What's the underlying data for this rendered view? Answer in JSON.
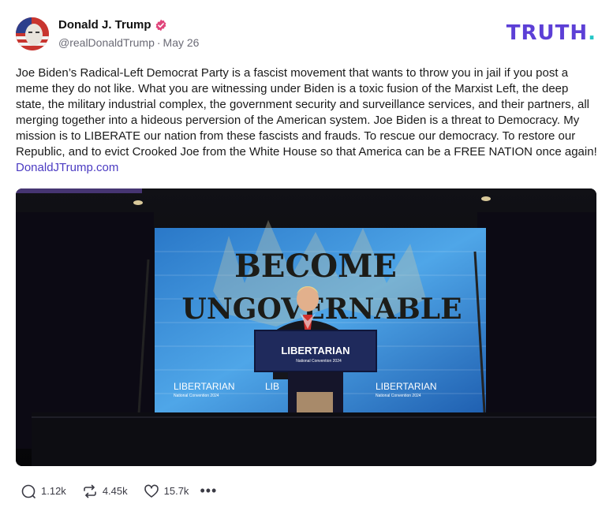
{
  "author": {
    "name": "Donald J. Trump",
    "handle": "@realDonaldTrump",
    "date": "May 26"
  },
  "brand": {
    "logo_text": "TRUTH",
    "logo_dot": ".",
    "color": "#5c3fd6",
    "dot_color": "#26c6c6"
  },
  "post": {
    "text": "Joe Biden’s Radical-Left Democrat Party is a fascist movement that wants to throw you in jail if you post a meme they do not like. What you are witnessing under Biden is a toxic fusion of the Marxist Left, the deep state, the military industrial complex, the government security and surveillance services, and their partners, all merging together into a hideous perversion of the American system. Joe Biden is a threat to Democracy. My mission is to LIBERATE our nation from these fascists and frauds. To rescue our democracy. To restore our Republic, and to evict Crooked Joe from the White House so that America can be a FREE NATION once again!",
    "link": "DonaldJTrump.com"
  },
  "image": {
    "screen_line1": "BECOME",
    "screen_line2": "UNGOVERNABLE",
    "podium_title": "LIBERTARIAN",
    "podium_subtitle": "National Convention 2024",
    "screen_sign": "LIBERTARIAN",
    "screen_sign_sub": "National Convention 2024",
    "screen_sign_mid": "LIB"
  },
  "stats": {
    "replies": "1.12k",
    "retruths": "4.45k",
    "likes": "15.7k",
    "more": "•••"
  }
}
